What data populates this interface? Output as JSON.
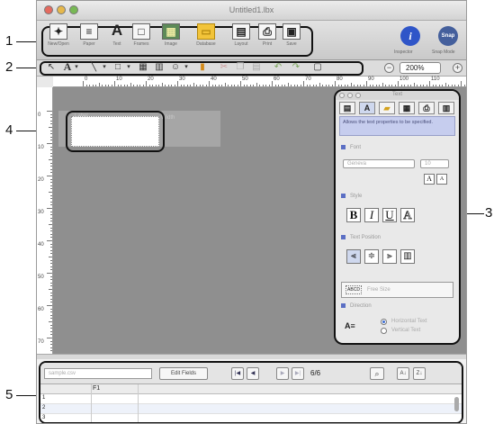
{
  "callouts": [
    {
      "id": "1",
      "label": "1"
    },
    {
      "id": "2",
      "label": "2"
    },
    {
      "id": "3",
      "label": "3"
    },
    {
      "id": "4",
      "label": "4"
    },
    {
      "id": "5",
      "label": "5"
    }
  ],
  "window": {
    "title": "Untitled1.lbx"
  },
  "main_toolbar": {
    "items": [
      {
        "icon": "new-icon",
        "glyph": "✦",
        "label": "New/Open"
      },
      {
        "icon": "paper-icon",
        "glyph": "≡",
        "label": "Paper"
      },
      {
        "icon": "text-icon",
        "glyph": "A",
        "label": "Text"
      },
      {
        "icon": "frame-icon",
        "glyph": "□",
        "label": "Frames"
      },
      {
        "icon": "image-icon",
        "glyph": "▦",
        "label": "Image"
      },
      {
        "icon": "database-icon",
        "glyph": "▭",
        "label": "Database"
      },
      {
        "icon": "layout-icon",
        "glyph": "▤",
        "label": "Layout"
      },
      {
        "icon": "print-icon",
        "glyph": "⎙",
        "label": "Print"
      },
      {
        "icon": "save-icon",
        "glyph": "▣",
        "label": "Save"
      }
    ],
    "inspector_label": "Inspector",
    "snap_mode_label": "Snap Mode",
    "snap_glyph": "Snap",
    "info_glyph": "i"
  },
  "sub_toolbar": {
    "tools": [
      {
        "icon": "arrow-icon",
        "glyph": "↖"
      },
      {
        "icon": "text-tool-icon",
        "glyph": "A"
      },
      {
        "icon": "dropdown-icon",
        "glyph": "▾"
      },
      {
        "icon": "line-icon",
        "glyph": "╲"
      },
      {
        "icon": "dropdown-icon",
        "glyph": "▾"
      },
      {
        "icon": "rectangle-icon",
        "glyph": "□"
      },
      {
        "icon": "dropdown-icon",
        "glyph": "▾"
      },
      {
        "icon": "table-icon",
        "glyph": "▦"
      },
      {
        "icon": "barcode-icon",
        "glyph": "▥"
      },
      {
        "icon": "clipart-icon",
        "glyph": "☺"
      },
      {
        "icon": "dropdown-icon",
        "glyph": "▾"
      },
      {
        "icon": "book-icon",
        "glyph": "▮"
      },
      {
        "icon": "cut-icon",
        "glyph": "✂"
      },
      {
        "icon": "copy-icon",
        "glyph": "❐"
      },
      {
        "icon": "paste-icon",
        "glyph": "▤"
      },
      {
        "icon": "undo-icon",
        "glyph": "↶"
      },
      {
        "icon": "redo-icon",
        "glyph": "↷"
      },
      {
        "icon": "grid-icon",
        "glyph": "▢"
      }
    ],
    "zoom_value": "200%",
    "zoom_out_glyph": "−",
    "zoom_in_glyph": "+"
  },
  "ruler": {
    "h_labels": [
      "0",
      "10",
      "20",
      "30",
      "40",
      "50",
      "60",
      "70",
      "80",
      "90",
      "100",
      "110"
    ],
    "v_labels": [
      "0",
      "10",
      "20",
      "30",
      "40",
      "50",
      "60",
      "70"
    ]
  },
  "canvas": {
    "ghost_a": "Label",
    "ghost_b": "Width"
  },
  "inspector": {
    "title": "Text",
    "tabs": [
      {
        "icon": "layout-tab-icon",
        "glyph": "▤"
      },
      {
        "icon": "text-tab-icon",
        "glyph": "A"
      },
      {
        "icon": "folder-tab-icon",
        "glyph": "▰"
      },
      {
        "icon": "layout2-tab-icon",
        "glyph": "▦"
      },
      {
        "icon": "print-tab-icon",
        "glyph": "⎙"
      },
      {
        "icon": "table-tab-icon",
        "glyph": "▥"
      }
    ],
    "description": "Allows the text properties to be specified.",
    "font_section": "Font",
    "font_name": "Geneva",
    "font_size": "10",
    "grow_glyph": "A",
    "shrink_glyph": "A",
    "style_section": "Style",
    "style_buttons": [
      {
        "icon": "bold-icon",
        "glyph": "B"
      },
      {
        "icon": "italic-icon",
        "glyph": "I"
      },
      {
        "icon": "underline-icon",
        "glyph": "U"
      },
      {
        "icon": "outline-icon",
        "glyph": "A"
      }
    ],
    "position_section": "Text Position",
    "align_buttons": [
      {
        "icon": "align-left-icon",
        "glyph": "⫷"
      },
      {
        "icon": "align-center-icon",
        "glyph": "≑"
      },
      {
        "icon": "align-right-icon",
        "glyph": "⫸"
      },
      {
        "icon": "justify-icon",
        "glyph": "▥"
      }
    ],
    "free_size_icon": "ABCD",
    "free_size_label": "Free Size",
    "direction_section": "Direction",
    "direction_glyph": "A≡",
    "horizontal_label": "Horizontal Text",
    "vertical_label": "Vertical Text"
  },
  "database": {
    "filename": "sample.csv",
    "edit_fields_label": "Edit Fields",
    "first_glyph": "|◀",
    "prev_glyph": "◀",
    "next_glyph": "▶",
    "last_glyph": "▶|",
    "record_count": "6/6",
    "search_glyph": "⌕",
    "sort_asc_glyph": "A↓",
    "sort_desc_glyph": "Z↓",
    "column_header": "F1",
    "rows": [
      "1",
      "2",
      "3"
    ]
  }
}
